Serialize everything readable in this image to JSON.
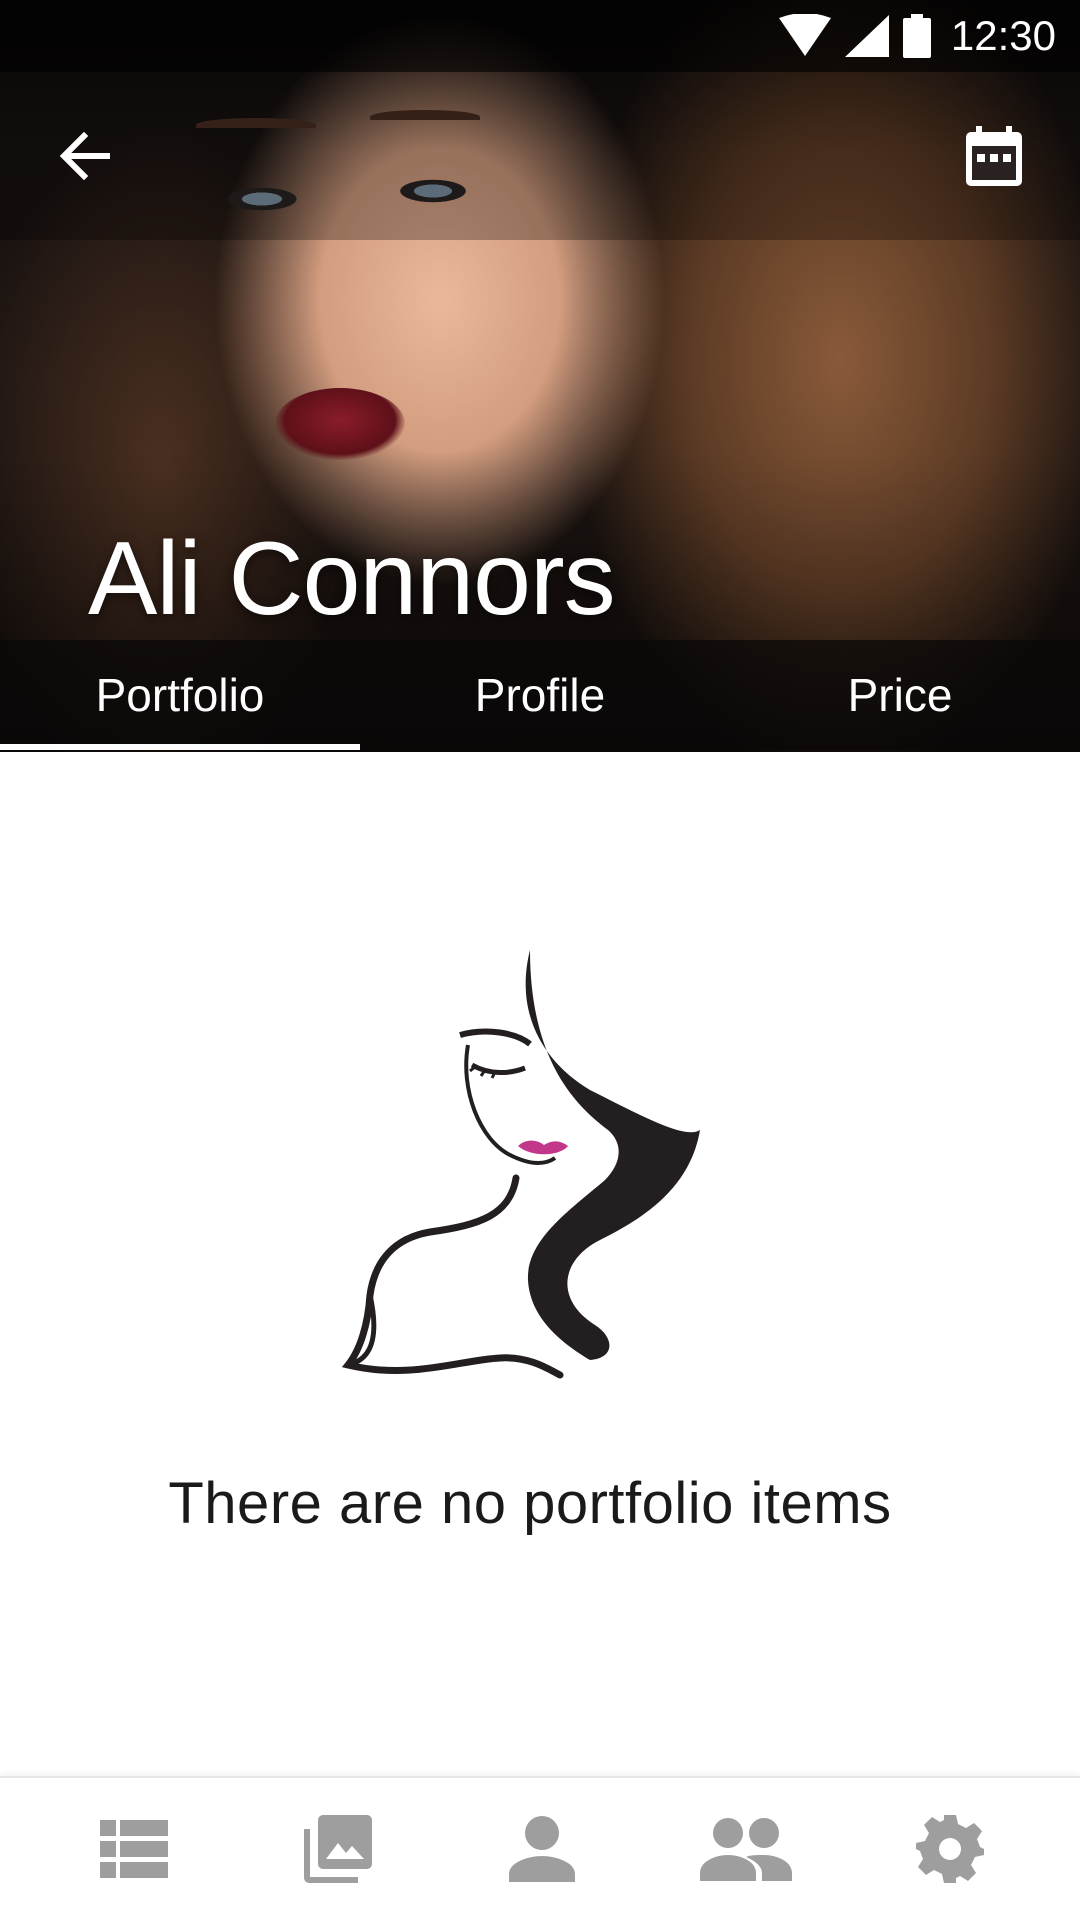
{
  "status_bar": {
    "time": "12:30"
  },
  "header": {
    "name": "Ali Connors",
    "back_icon": "arrow-back-icon",
    "action_icon": "calendar-icon"
  },
  "tabs": [
    {
      "label": "Portfolio",
      "selected": true
    },
    {
      "label": "Profile",
      "selected": false
    },
    {
      "label": "Price",
      "selected": false
    }
  ],
  "empty_state": {
    "illustration": "woman-silhouette-logo",
    "message": "There are no portfolio items"
  },
  "bottom_nav": [
    {
      "icon": "list-icon"
    },
    {
      "icon": "photo-library-icon"
    },
    {
      "icon": "person-icon"
    },
    {
      "icon": "people-icon"
    },
    {
      "icon": "settings-gear-icon"
    }
  ],
  "colors": {
    "nav_icon": "#9e9e9e",
    "lips_accent": "#c2378a",
    "text_primary": "#1a1a1a"
  }
}
